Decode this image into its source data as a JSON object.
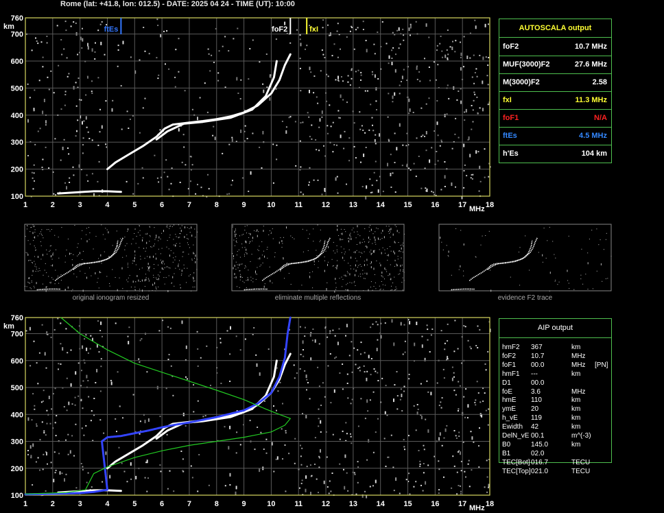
{
  "header": "Rome (lat: +41.8, lon: 012.5) - DATE: 2025 04 24 - TIME (UT): 10:00",
  "chart_data": [
    {
      "type": "scatter",
      "xlabel": "MHz",
      "ylabel": "km",
      "xlim": [
        1,
        18
      ],
      "ylim": [
        100,
        760
      ],
      "x_ticks": [
        "1",
        "2",
        "3",
        "4",
        "5",
        "6",
        "7",
        "8",
        "9",
        "10",
        "11",
        "12",
        "13",
        "14",
        "15",
        "16",
        "17",
        "18"
      ],
      "y_ticks": [
        "100",
        "200",
        "300",
        "400",
        "500",
        "600",
        "700",
        "760"
      ],
      "markers": [
        {
          "label": "ftEs",
          "x": 4.5,
          "color": "#3377ff"
        },
        {
          "label": "foF2",
          "x": 10.7,
          "color": "#ffffff"
        },
        {
          "label": "fxI",
          "x": 11.3,
          "color": "#ffff33"
        }
      ],
      "series": [
        {
          "color": "#ffffff",
          "points": [
            [
              4.0,
              200
            ],
            [
              4.3,
              225
            ],
            [
              4.8,
              255
            ],
            [
              5.3,
              285
            ],
            [
              5.8,
              320
            ],
            [
              6.1,
              350
            ],
            [
              6.4,
              365
            ],
            [
              7.0,
              372
            ],
            [
              7.5,
              378
            ],
            [
              8.0,
              385
            ],
            [
              8.5,
              395
            ],
            [
              9.0,
              410
            ],
            [
              9.5,
              435
            ],
            [
              10.0,
              480
            ],
            [
              10.3,
              530
            ],
            [
              10.5,
              585
            ],
            [
              10.7,
              625
            ]
          ]
        },
        {
          "color": "#ffffff",
          "points": [
            [
              5.8,
              310
            ],
            [
              6.2,
              340
            ],
            [
              6.8,
              368
            ],
            [
              7.5,
              375
            ],
            [
              8.5,
              390
            ],
            [
              9.3,
              420
            ],
            [
              9.8,
              470
            ],
            [
              10.1,
              540
            ],
            [
              10.2,
              600
            ]
          ]
        },
        {
          "color": "#ffffff",
          "points": [
            [
              2.2,
              110
            ],
            [
              3.0,
              115
            ],
            [
              3.5,
              118
            ],
            [
              4.0,
              118
            ],
            [
              4.5,
              116
            ]
          ]
        }
      ]
    },
    {
      "type": "scatter",
      "xlabel": "MHz",
      "ylabel": "km",
      "xlim": [
        1,
        18
      ],
      "ylim": [
        100,
        760
      ],
      "x_ticks": [
        "1",
        "2",
        "3",
        "4",
        "5",
        "6",
        "7",
        "8",
        "9",
        "10",
        "11",
        "12",
        "13",
        "14",
        "15",
        "16",
        "17",
        "18"
      ],
      "y_ticks": [
        "100",
        "200",
        "300",
        "400",
        "500",
        "600",
        "700",
        "760"
      ],
      "series": [
        {
          "color": "#ffffff",
          "points": [
            [
              4.0,
              200
            ],
            [
              4.3,
              225
            ],
            [
              4.8,
              255
            ],
            [
              5.3,
              285
            ],
            [
              5.8,
              320
            ],
            [
              6.1,
              350
            ],
            [
              6.4,
              365
            ],
            [
              7.0,
              372
            ],
            [
              7.5,
              378
            ],
            [
              8.0,
              385
            ],
            [
              8.5,
              395
            ],
            [
              9.0,
              410
            ],
            [
              9.5,
              435
            ],
            [
              10.0,
              480
            ],
            [
              10.3,
              530
            ],
            [
              10.5,
              585
            ],
            [
              10.7,
              625
            ]
          ]
        },
        {
          "color": "#ffffff",
          "points": [
            [
              5.8,
              310
            ],
            [
              6.2,
              340
            ],
            [
              6.8,
              368
            ],
            [
              7.5,
              375
            ],
            [
              8.5,
              390
            ],
            [
              9.3,
              420
            ],
            [
              9.8,
              470
            ],
            [
              10.1,
              540
            ],
            [
              10.2,
              600
            ]
          ]
        },
        {
          "color": "#ffffff",
          "points": [
            [
              2.2,
              110
            ],
            [
              3.0,
              115
            ],
            [
              3.5,
              118
            ],
            [
              4.0,
              118
            ],
            [
              4.5,
              116
            ]
          ]
        },
        {
          "color": "#3344ff",
          "points": [
            [
              1.0,
              103
            ],
            [
              2.0,
              105
            ],
            [
              3.0,
              108
            ],
            [
              3.5,
              112
            ],
            [
              4.0,
              120
            ],
            [
              3.8,
              300
            ],
            [
              4.0,
              315
            ],
            [
              4.5,
              320
            ],
            [
              5.0,
              330
            ],
            [
              5.5,
              340
            ],
            [
              6.0,
              352
            ],
            [
              6.5,
              362
            ],
            [
              7.0,
              370
            ],
            [
              8.0,
              390
            ],
            [
              9.0,
              415
            ],
            [
              9.5,
              440
            ],
            [
              10.0,
              480
            ],
            [
              10.3,
              540
            ],
            [
              10.5,
              610
            ],
            [
              10.6,
              700
            ],
            [
              10.7,
              760
            ]
          ]
        },
        {
          "color": "#22cc22",
          "points": [
            [
              2.3,
              760
            ],
            [
              3.0,
              700
            ],
            [
              4.0,
              640
            ],
            [
              5.0,
              590
            ],
            [
              6.5,
              540
            ],
            [
              8.0,
              490
            ],
            [
              9.0,
              455
            ],
            [
              9.8,
              420
            ],
            [
              10.3,
              400
            ],
            [
              10.7,
              385
            ],
            [
              10.5,
              360
            ],
            [
              10.0,
              335
            ],
            [
              9.0,
              315
            ],
            [
              8.0,
              300
            ],
            [
              7.0,
              285
            ],
            [
              6.0,
              265
            ],
            [
              5.0,
              240
            ],
            [
              4.0,
              205
            ],
            [
              3.5,
              180
            ],
            [
              3.3,
              140
            ],
            [
              3.2,
              120
            ],
            [
              2.5,
              110
            ],
            [
              1.0,
              104
            ]
          ]
        }
      ]
    }
  ],
  "thumbnails": [
    {
      "caption": "original ionogram resized"
    },
    {
      "caption": "eliminate multiple reflections"
    },
    {
      "caption": "evidence F2 trace"
    }
  ],
  "autoscala": {
    "title": "AUTOSCALA output",
    "rows": [
      {
        "label": "foF2",
        "value": "10.7 MHz",
        "color": "#ffffff"
      },
      {
        "label": "MUF(3000)F2",
        "value": "27.6 MHz",
        "color": "#ffffff"
      },
      {
        "label": "M(3000)F2",
        "value": "2.58",
        "color": "#ffffff"
      },
      {
        "label": "fxI",
        "value": "11.3 MHz",
        "color": "#ffff33"
      },
      {
        "label": "foF1",
        "value": "N/A",
        "color": "#ff2222"
      },
      {
        "label": "ftEs",
        "value": "4.5 MHz",
        "color": "#3388ff"
      },
      {
        "label": "h'Es",
        "value": "104    km",
        "color": "#ffffff"
      }
    ]
  },
  "aip": {
    "title": "AIP output",
    "rows": [
      {
        "name": "hmF2",
        "value": "367",
        "unit": "km",
        "extra": ""
      },
      {
        "name": "foF2",
        "value": "10.7",
        "unit": "MHz",
        "extra": ""
      },
      {
        "name": "foF1",
        "value": "00.0",
        "unit": "MHz",
        "extra": "[PN]"
      },
      {
        "name": "hmF1",
        "value": "---",
        "unit": "km",
        "extra": ""
      },
      {
        "name": "D1",
        "value": "00.0",
        "unit": "",
        "extra": ""
      },
      {
        "name": "foE",
        "value": "3.6",
        "unit": "MHz",
        "extra": ""
      },
      {
        "name": "hmE",
        "value": "110",
        "unit": "km",
        "extra": ""
      },
      {
        "name": "ymE",
        "value": "20",
        "unit": "km",
        "extra": ""
      },
      {
        "name": "h_vE",
        "value": "119",
        "unit": "km",
        "extra": ""
      },
      {
        "name": "Ewidth",
        "value": "42",
        "unit": "km",
        "extra": ""
      },
      {
        "name": "DelN_vE",
        "value": "00.1",
        "unit": "m^(-3)",
        "extra": ""
      },
      {
        "name": "B0",
        "value": "145.0",
        "unit": "km",
        "extra": ""
      },
      {
        "name": "B1",
        "value": "02.0",
        "unit": "",
        "extra": ""
      },
      {
        "name": "TEC[Bot]",
        "value": "016.7",
        "unit": "TECU",
        "extra": ""
      },
      {
        "name": "TEC[Top]",
        "value": "021.0",
        "unit": "TECU",
        "extra": ""
      }
    ]
  }
}
